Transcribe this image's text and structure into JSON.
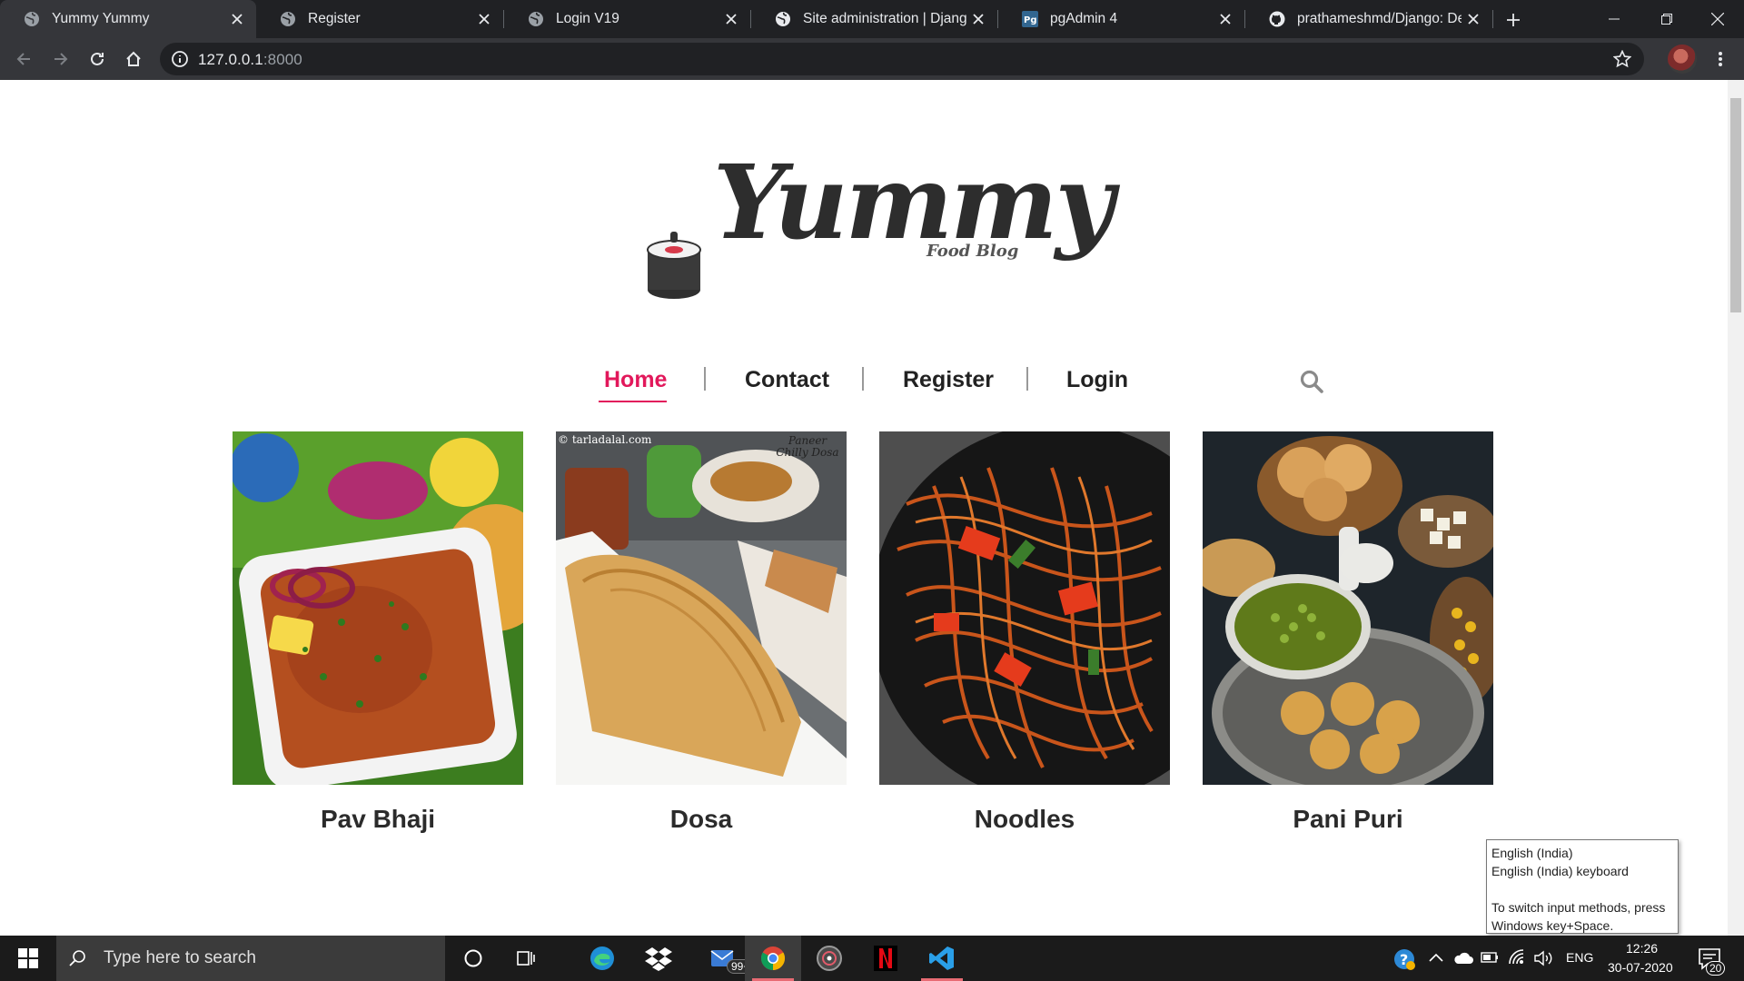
{
  "browser": {
    "tabs": [
      {
        "title": "Yummy Yummy",
        "active": true
      },
      {
        "title": "Register",
        "active": false
      },
      {
        "title": "Login V19",
        "active": false
      },
      {
        "title": "Site administration | Django",
        "active": false
      },
      {
        "title": "pgAdmin 4",
        "active": false
      },
      {
        "title": "prathameshmd/Django: Dev",
        "active": false
      }
    ],
    "url_host": "127.0.0.1",
    "url_port": ":8000"
  },
  "page": {
    "logo": {
      "word": "Yummy",
      "subtitle": "Food Blog"
    },
    "nav": [
      {
        "label": "Home",
        "active": true
      },
      {
        "label": "Contact",
        "active": false
      },
      {
        "label": "Register",
        "active": false
      },
      {
        "label": "Login",
        "active": false
      }
    ],
    "cards": [
      {
        "title": "Pav Bhaji"
      },
      {
        "title": "Dosa",
        "watermark": "© tarladalal.com",
        "overlay": "Paneer Chilly Dosa"
      },
      {
        "title": "Noodles"
      },
      {
        "title": "Pani Puri"
      }
    ],
    "accent_color": "#e2185b"
  },
  "ime_tooltip": {
    "line1": "English (India)",
    "line2": "English (India) keyboard",
    "line3": "To switch input methods, press Windows key+Space."
  },
  "taskbar": {
    "search_placeholder": "Type here to search",
    "mail_badge": "99+",
    "language": "ENG",
    "time": "12:26",
    "date": "30-07-2020",
    "notifications": "20"
  }
}
